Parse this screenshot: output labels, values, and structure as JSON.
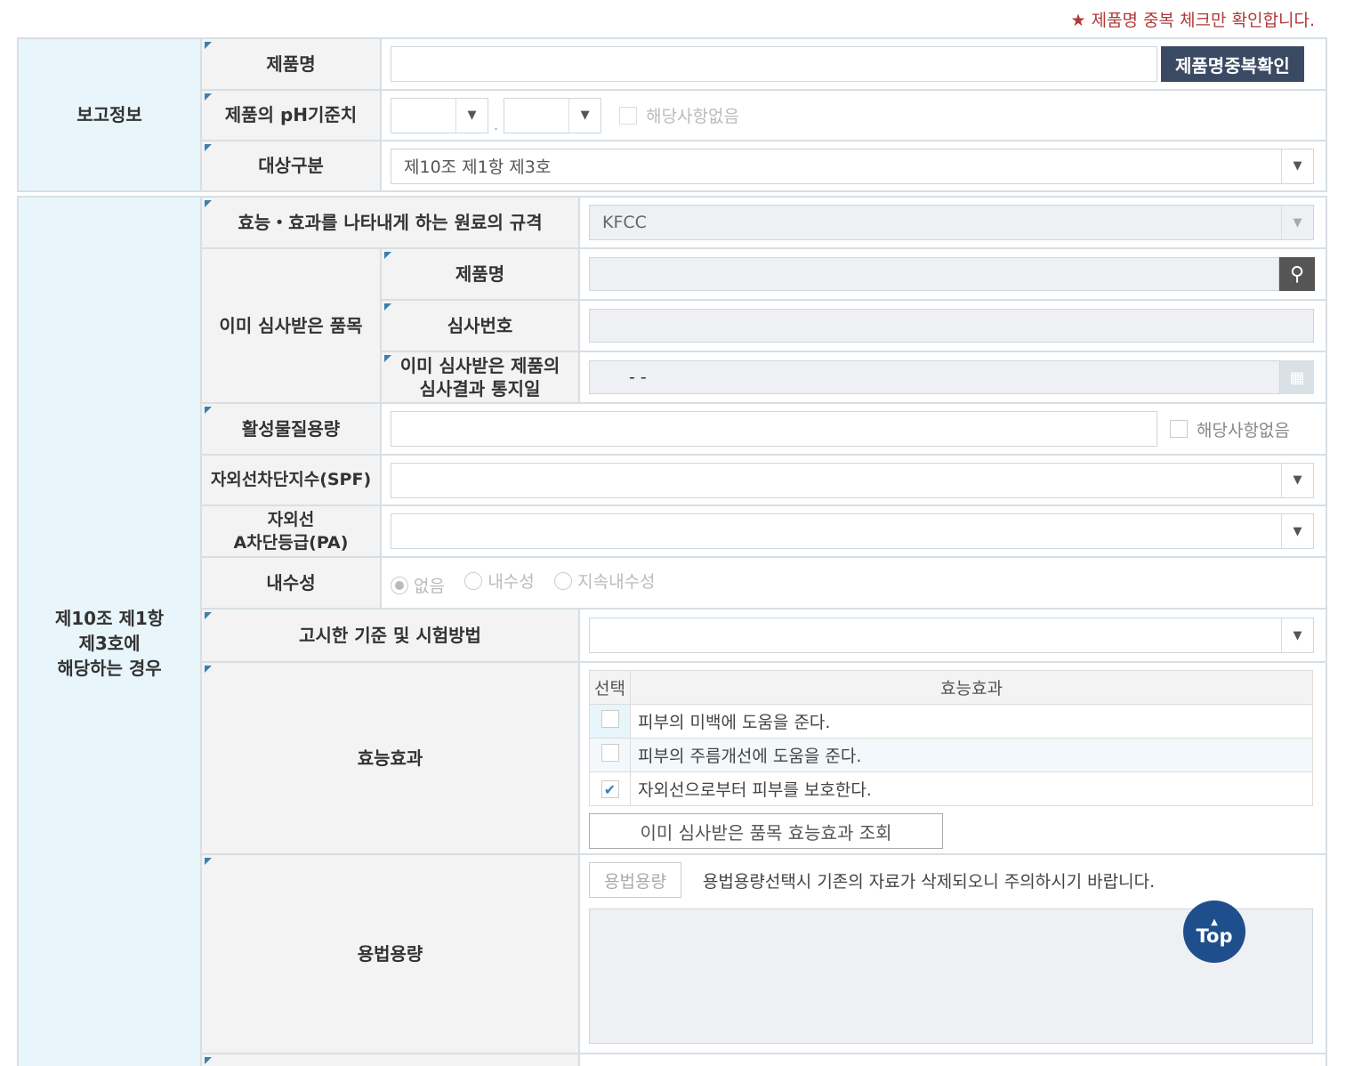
{
  "notice": "★ 제품명 중복 체크만 확인합니다.",
  "report_section": {
    "title": "보고정보",
    "product_name_label": "제품명",
    "dup_check_button": "제품명중복확인",
    "ph_label": "제품의 pH기준치",
    "ph_separator": ".",
    "ph_not_applicable": "해당사항없음",
    "target_label": "대상구분",
    "target_value": "제10조 제1항 제3호"
  },
  "case_section": {
    "title_line1": "제10조 제1항",
    "title_line2": "제3호에",
    "title_line3": "해당하는 경우",
    "raw_spec_label": "효능・효과를 나타내게 하는 원료의 규격",
    "raw_spec_value": "KFCC",
    "reviewed_item_label": "이미 심사받은 품목",
    "reviewed_product_label": "제품명",
    "review_number_label": "심사번호",
    "review_date_label_1": "이미 심사받은 제품의",
    "review_date_label_2": "심사결과 통지일",
    "review_date_value": "-   -",
    "active_amount_label": "활성물질용량",
    "active_amount_na": "해당사항없음",
    "spf_label": "자외선차단지수(SPF)",
    "pa_label_1": "자외선",
    "pa_label_2": "A차단등급(PA)",
    "water_label": "내수성",
    "water_options": [
      "없음",
      "내수성",
      "지속내수성"
    ],
    "method_label": "고시한 기준 및 시험방법",
    "efficacy_label": "효능효과",
    "efficacy_table": {
      "col_select": "선택",
      "col_effect": "효능효과",
      "rows": [
        {
          "text": "피부의 미백에 도움을 준다.",
          "checked": false
        },
        {
          "text": "피부의 주름개선에 도움을 준다.",
          "checked": false
        },
        {
          "text": "자외선으로부터 피부를 보호한다.",
          "checked": true
        }
      ]
    },
    "efficacy_lookup_button": "이미 심사받은 품목 효능효과 조회",
    "dosage_label": "용법용량",
    "dosage_button": "용법용량",
    "dosage_warning": "용법용량선택시 기존의 자료가 삭제되오니 주의하시기 바랍니다."
  },
  "top_button": "Top",
  "colors": {
    "section_bg": "#e8f5fa",
    "dark_button": "#3b4a63",
    "top_button": "#1f4e8c",
    "notice": "#b03a3a"
  }
}
